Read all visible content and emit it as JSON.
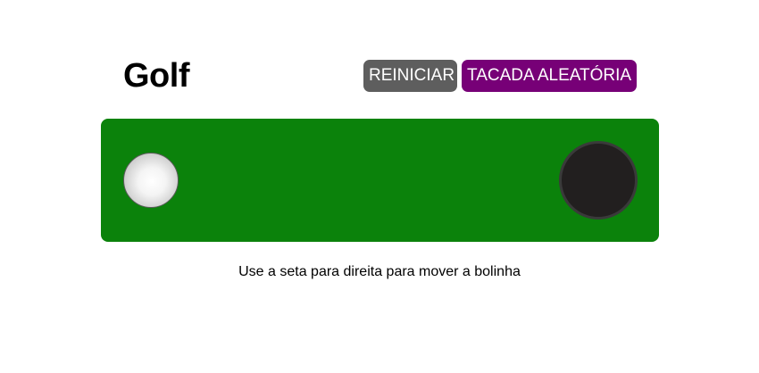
{
  "title": "Golf",
  "controls": {
    "reset_label": "REINICIAR",
    "random_shot_label": "TACADA ALEATÓRIA"
  },
  "game": {
    "ball_progress": 0,
    "course_color": "#0b820b",
    "ball_color": "#ffffff",
    "hole_color": "#221f1f"
  },
  "instruction": "Use a seta para direita para mover a bolinha",
  "colors": {
    "reset_button": "#5e5e5e",
    "random_button": "#770077"
  }
}
